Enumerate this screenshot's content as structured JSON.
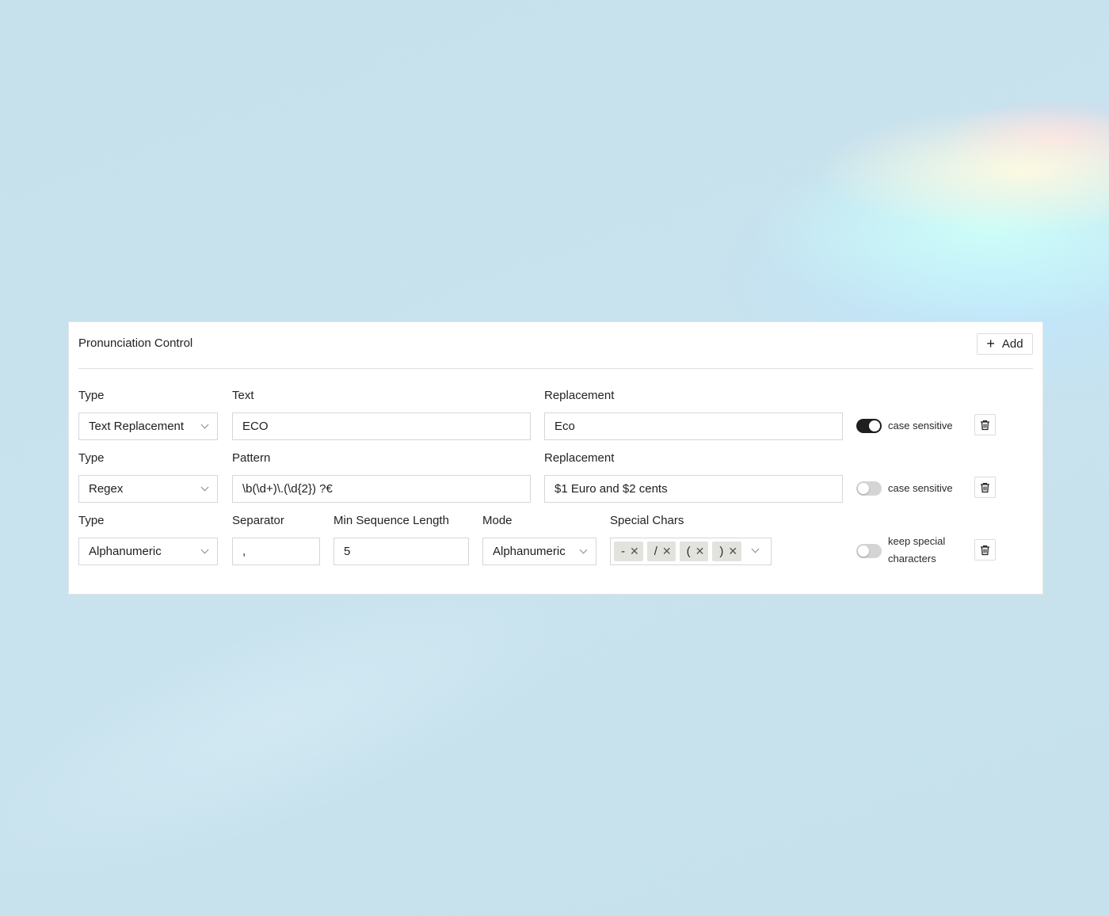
{
  "panel": {
    "title": "Pronunciation Control",
    "add_label": "Add"
  },
  "rows": [
    {
      "type_label": "Type",
      "type_value": "Text Replacement",
      "text_label": "Text",
      "text_value": "ECO",
      "replacement_label": "Replacement",
      "replacement_value": "Eco",
      "toggle_label": "case sensitive",
      "toggle_on": true
    },
    {
      "type_label": "Type",
      "type_value": "Regex",
      "pattern_label": "Pattern",
      "pattern_value": "\\b(\\d+)\\.(\\d{2}) ?€",
      "replacement_label": "Replacement",
      "replacement_value": "$1 Euro and $2 cents",
      "toggle_label": "case sensitive",
      "toggle_on": false
    },
    {
      "type_label": "Type",
      "type_value": "Alphanumeric",
      "separator_label": "Separator",
      "separator_value": ",",
      "min_seq_label": "Min Sequence Length",
      "min_seq_value": "5",
      "mode_label": "Mode",
      "mode_value": "Alphanumeric",
      "special_chars_label": "Special Chars",
      "special_chars": [
        "-",
        "/",
        "(",
        ")"
      ],
      "toggle_label_line1": "keep special",
      "toggle_label_line2": "characters",
      "toggle_on": false
    }
  ],
  "icons": {
    "add": "plus-icon",
    "delete": "trash-icon",
    "remove_tag": "close-icon",
    "dropdown": "chevron-down-icon"
  },
  "colors": {
    "toggle_on": "#1f1f1f",
    "toggle_off": "#d4d4d4",
    "tag_bg": "#e3e3de"
  }
}
